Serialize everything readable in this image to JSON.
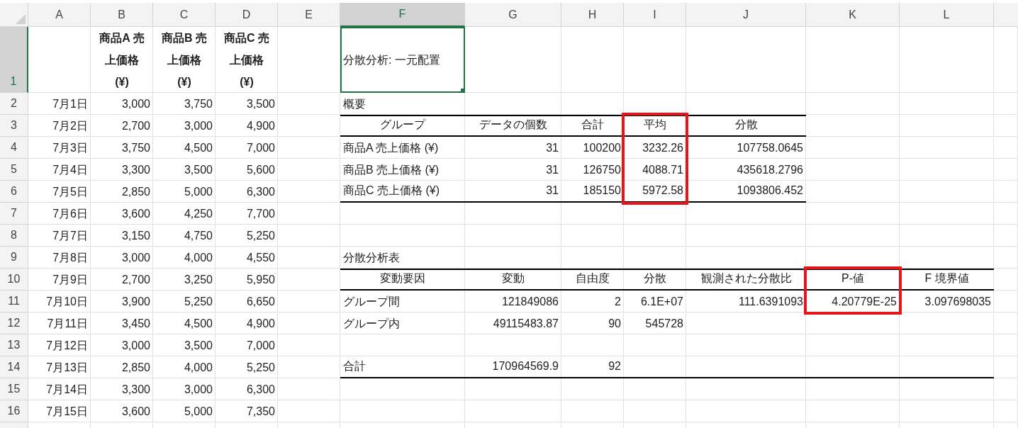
{
  "columns": [
    {
      "label": "A",
      "selected": false
    },
    {
      "label": "B",
      "selected": false
    },
    {
      "label": "C",
      "selected": false
    },
    {
      "label": "D",
      "selected": false
    },
    {
      "label": "E",
      "selected": false
    },
    {
      "label": "F",
      "selected": true
    },
    {
      "label": "G",
      "selected": false
    },
    {
      "label": "H",
      "selected": false
    },
    {
      "label": "I",
      "selected": false
    },
    {
      "label": "J",
      "selected": false
    },
    {
      "label": "K",
      "selected": false
    },
    {
      "label": "L",
      "selected": false
    }
  ],
  "rows": [
    {
      "header": "1",
      "selected": true,
      "cells": {
        "B": {
          "text": "商品A 売上価格 (¥)",
          "kind": "column-title"
        },
        "C": {
          "text": "商品B 売上価格 (¥)",
          "kind": "column-title"
        },
        "D": {
          "text": "商品C 売上価格 (¥)",
          "kind": "column-title"
        },
        "F": {
          "text": "分散分析: 一元配置",
          "kind": "title"
        }
      }
    },
    {
      "header": "2",
      "selected": false,
      "cells": {
        "A": {
          "text": "7月1日",
          "kind": "value"
        },
        "B": {
          "text": "3,000",
          "kind": "value"
        },
        "C": {
          "text": "3,750",
          "kind": "value"
        },
        "D": {
          "text": "3,500",
          "kind": "value"
        },
        "F": {
          "text": "概要",
          "kind": "label"
        }
      }
    },
    {
      "header": "3",
      "selected": false,
      "cells": {
        "A": {
          "text": "7月2日",
          "kind": "value"
        },
        "B": {
          "text": "2,700",
          "kind": "value"
        },
        "C": {
          "text": "3,000",
          "kind": "value"
        },
        "D": {
          "text": "4,900",
          "kind": "value"
        },
        "F": {
          "text": "グループ",
          "kind": "heading",
          "rule_above": true,
          "rule_below": true
        },
        "G": {
          "text": "データの個数",
          "kind": "heading",
          "rule_above": true,
          "rule_below": true
        },
        "H": {
          "text": "合計",
          "kind": "heading",
          "rule_above": true,
          "rule_below": true
        },
        "I": {
          "text": "平均",
          "kind": "heading",
          "rule_above": true,
          "rule_below": true,
          "highlighted": true
        },
        "J": {
          "text": "分散",
          "kind": "heading",
          "rule_above": true,
          "rule_below": true
        }
      }
    },
    {
      "header": "4",
      "selected": false,
      "cells": {
        "A": {
          "text": "7月3日",
          "kind": "value"
        },
        "B": {
          "text": "3,750",
          "kind": "value"
        },
        "C": {
          "text": "4,500",
          "kind": "value"
        },
        "D": {
          "text": "7,000",
          "kind": "value"
        },
        "F": {
          "text": "商品A 売上価格 (¥)",
          "kind": "label"
        },
        "G": {
          "text": "31",
          "kind": "value"
        },
        "H": {
          "text": "100200",
          "kind": "value"
        },
        "I": {
          "text": "3232.26",
          "kind": "value",
          "highlighted": true
        },
        "J": {
          "text": "107758.0645",
          "kind": "value"
        }
      }
    },
    {
      "header": "5",
      "selected": false,
      "cells": {
        "A": {
          "text": "7月4日",
          "kind": "value"
        },
        "B": {
          "text": "3,300",
          "kind": "value"
        },
        "C": {
          "text": "3,500",
          "kind": "value"
        },
        "D": {
          "text": "5,600",
          "kind": "value"
        },
        "F": {
          "text": "商品B 売上価格 (¥)",
          "kind": "label"
        },
        "G": {
          "text": "31",
          "kind": "value"
        },
        "H": {
          "text": "126750",
          "kind": "value"
        },
        "I": {
          "text": "4088.71",
          "kind": "value",
          "highlighted": true
        },
        "J": {
          "text": "435618.2796",
          "kind": "value"
        }
      }
    },
    {
      "header": "6",
      "selected": false,
      "cells": {
        "A": {
          "text": "7月5日",
          "kind": "value"
        },
        "B": {
          "text": "2,850",
          "kind": "value"
        },
        "C": {
          "text": "5,000",
          "kind": "value"
        },
        "D": {
          "text": "6,300",
          "kind": "value"
        },
        "F": {
          "text": "商品C 売上価格 (¥)",
          "kind": "label",
          "rule_below": true
        },
        "G": {
          "text": "31",
          "kind": "value",
          "rule_below": true
        },
        "H": {
          "text": "185150",
          "kind": "value",
          "rule_below": true
        },
        "I": {
          "text": "5972.58",
          "kind": "value",
          "highlighted": true,
          "rule_below": true
        },
        "J": {
          "text": "1093806.452",
          "kind": "value",
          "rule_below": true
        }
      }
    },
    {
      "header": "7",
      "selected": false,
      "cells": {
        "A": {
          "text": "7月6日",
          "kind": "value"
        },
        "B": {
          "text": "3,600",
          "kind": "value"
        },
        "C": {
          "text": "4,250",
          "kind": "value"
        },
        "D": {
          "text": "7,700",
          "kind": "value"
        }
      }
    },
    {
      "header": "8",
      "selected": false,
      "cells": {
        "A": {
          "text": "7月7日",
          "kind": "value"
        },
        "B": {
          "text": "3,150",
          "kind": "value"
        },
        "C": {
          "text": "4,750",
          "kind": "value"
        },
        "D": {
          "text": "5,250",
          "kind": "value"
        }
      }
    },
    {
      "header": "9",
      "selected": false,
      "cells": {
        "A": {
          "text": "7月8日",
          "kind": "value"
        },
        "B": {
          "text": "3,000",
          "kind": "value"
        },
        "C": {
          "text": "4,000",
          "kind": "value"
        },
        "D": {
          "text": "4,550",
          "kind": "value"
        },
        "F": {
          "text": "分散分析表",
          "kind": "label"
        }
      }
    },
    {
      "header": "10",
      "selected": false,
      "cells": {
        "A": {
          "text": "7月9日",
          "kind": "value"
        },
        "B": {
          "text": "2,700",
          "kind": "value"
        },
        "C": {
          "text": "3,250",
          "kind": "value"
        },
        "D": {
          "text": "5,950",
          "kind": "value"
        },
        "F": {
          "text": "変動要因",
          "kind": "heading",
          "rule_above": true,
          "rule_below": true
        },
        "G": {
          "text": "変動",
          "kind": "heading",
          "rule_above": true,
          "rule_below": true
        },
        "H": {
          "text": "自由度",
          "kind": "heading",
          "rule_above": true,
          "rule_below": true
        },
        "I": {
          "text": "分散",
          "kind": "heading",
          "rule_above": true,
          "rule_below": true
        },
        "J": {
          "text": "観測された分散比",
          "kind": "heading",
          "rule_above": true,
          "rule_below": true
        },
        "K": {
          "text": "P-値",
          "kind": "heading",
          "rule_above": true,
          "rule_below": true,
          "highlighted": true
        },
        "L": {
          "text": "F 境界値",
          "kind": "heading",
          "rule_above": true,
          "rule_below": true
        }
      }
    },
    {
      "header": "11",
      "selected": false,
      "cells": {
        "A": {
          "text": "7月10日",
          "kind": "value"
        },
        "B": {
          "text": "3,900",
          "kind": "value"
        },
        "C": {
          "text": "5,250",
          "kind": "value"
        },
        "D": {
          "text": "6,650",
          "kind": "value"
        },
        "F": {
          "text": "グループ間",
          "kind": "label"
        },
        "G": {
          "text": "121849086",
          "kind": "value"
        },
        "H": {
          "text": "2",
          "kind": "value"
        },
        "I": {
          "text": "6.1E+07",
          "kind": "value"
        },
        "J": {
          "text": "111.6391093",
          "kind": "value"
        },
        "K": {
          "text": "4.20779E-25",
          "kind": "value",
          "highlighted": true
        },
        "L": {
          "text": "3.097698035",
          "kind": "value"
        }
      }
    },
    {
      "header": "12",
      "selected": false,
      "cells": {
        "A": {
          "text": "7月11日",
          "kind": "value"
        },
        "B": {
          "text": "3,450",
          "kind": "value"
        },
        "C": {
          "text": "4,500",
          "kind": "value"
        },
        "D": {
          "text": "4,900",
          "kind": "value"
        },
        "F": {
          "text": "グループ内",
          "kind": "label"
        },
        "G": {
          "text": "49115483.87",
          "kind": "value"
        },
        "H": {
          "text": "90",
          "kind": "value"
        },
        "I": {
          "text": "545728",
          "kind": "value"
        }
      }
    },
    {
      "header": "13",
      "selected": false,
      "cells": {
        "A": {
          "text": "7月12日",
          "kind": "value"
        },
        "B": {
          "text": "3,000",
          "kind": "value"
        },
        "C": {
          "text": "3,500",
          "kind": "value"
        },
        "D": {
          "text": "7,000",
          "kind": "value"
        }
      }
    },
    {
      "header": "14",
      "selected": false,
      "cells": {
        "A": {
          "text": "7月13日",
          "kind": "value"
        },
        "B": {
          "text": "2,850",
          "kind": "value"
        },
        "C": {
          "text": "4,000",
          "kind": "value"
        },
        "D": {
          "text": "5,250",
          "kind": "value"
        },
        "F": {
          "text": "合計",
          "kind": "label",
          "rule_below": true
        },
        "G": {
          "text": "170964569.9",
          "kind": "value",
          "rule_below": true
        },
        "H": {
          "text": "92",
          "kind": "value",
          "rule_below": true
        },
        "I": {
          "rule_below": true
        },
        "J": {
          "rule_below": true
        },
        "K": {
          "rule_below": true
        },
        "L": {
          "rule_below": true
        }
      }
    },
    {
      "header": "15",
      "selected": false,
      "cells": {
        "A": {
          "text": "7月14日",
          "kind": "value"
        },
        "B": {
          "text": "3,300",
          "kind": "value"
        },
        "C": {
          "text": "3,000",
          "kind": "value"
        },
        "D": {
          "text": "6,300",
          "kind": "value"
        }
      }
    },
    {
      "header": "16",
      "selected": false,
      "cells": {
        "A": {
          "text": "7月15日",
          "kind": "value"
        },
        "B": {
          "text": "3,600",
          "kind": "value"
        },
        "C": {
          "text": "5,000",
          "kind": "value"
        },
        "D": {
          "text": "7,350",
          "kind": "value"
        }
      }
    }
  ]
}
